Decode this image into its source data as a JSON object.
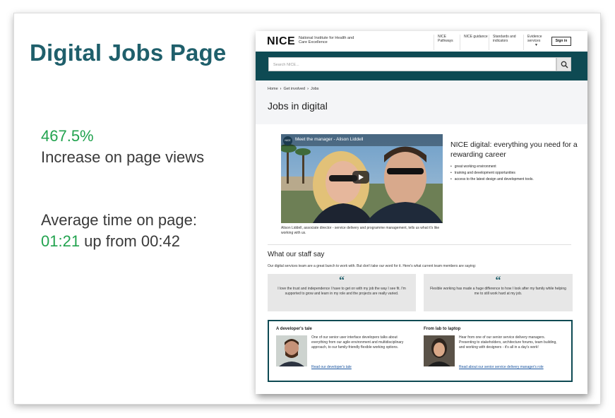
{
  "slide": {
    "title": "Digital Jobs Page",
    "stat1_value": "467.5%",
    "stat1_label": "Increase on page views",
    "stat2_label": "Average time on page:",
    "stat2_value": "01:21",
    "stat2_suffix": " up from 00:42"
  },
  "colors": {
    "title": "#1f5f6b",
    "highlight": "#22a34f",
    "nice_band": "#0e4a53"
  },
  "nice": {
    "logo": "NICE",
    "logo_sub": "National Institute for Health and Care Excellence",
    "nav": [
      "NICE Pathways",
      "NICE guidance",
      "Standards and indicators",
      "Evidence services"
    ],
    "sign_in": "Sign in",
    "search_placeholder": "Search NICE...",
    "breadcrumb": [
      "Home",
      "Get involved",
      "Jobs"
    ],
    "page_title": "Jobs in digital",
    "video_title": "Meet the manager - Alison Liddell",
    "video_logo": "NICE",
    "video_caption": "Alison Liddell, associate director - service delivery and programme management, tells us what it's like working with us.",
    "intro_heading": "NICE digital: everything you need for a rewarding career",
    "intro_points": [
      "great working environment",
      "training and development opportunities",
      "access to the latest design and development tools."
    ],
    "staff_heading": "What our staff say",
    "staff_intro": "Our digital services team are a great bunch to work with. But don't take our word for it. Here's what current team members are saying:",
    "quotes": [
      "I love the trust and independence I have to get on with my job the way I see fit. I'm supported to grow and learn in my role and the projects are really varied.",
      "Flexible working has made a huge difference to how I look after my family while helping me to still work hard at my job."
    ],
    "tales": [
      {
        "heading": "A developer's tale",
        "text": "One of our senior user interface developers talks about everything from our agile environment and multidisciplinary approach, to our family-friendly flexible working options.",
        "link": "Read our developer's tale"
      },
      {
        "heading": "From lab to laptop",
        "text": "Hear from one of our senior service delivery managers. Presenting to stakeholders, architecture forums, team building, and working with designers - it's all in a day's work!",
        "link": "Read about our senior service delivery manager's role"
      }
    ]
  }
}
